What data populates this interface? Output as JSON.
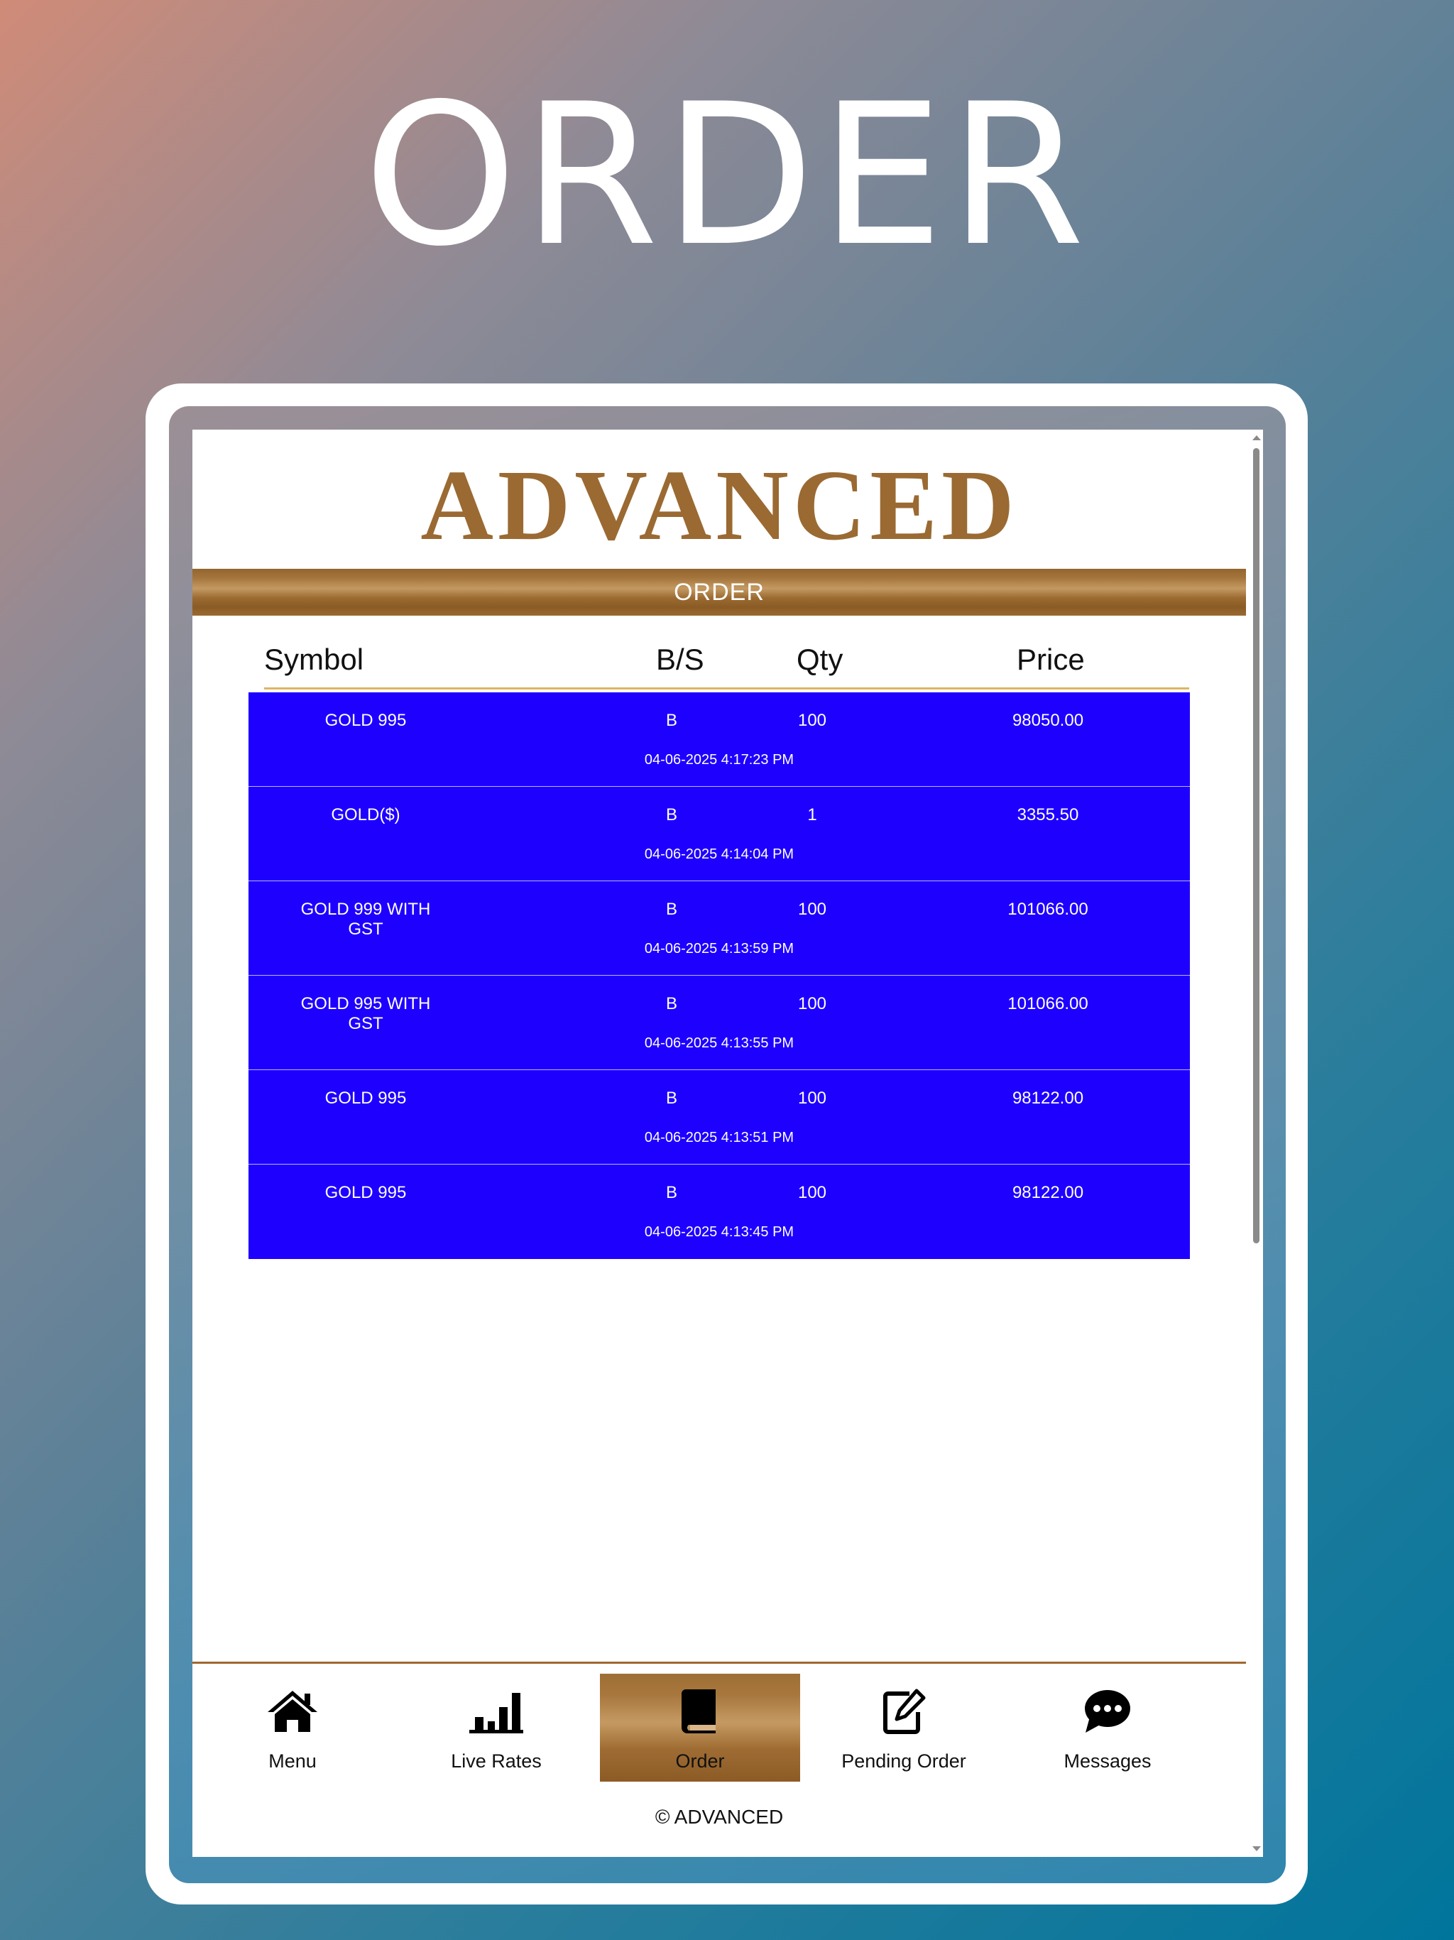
{
  "promo": {
    "title": "ORDER"
  },
  "app": {
    "logo_text": "ADVANCED",
    "section_title": "ORDER",
    "colors": {
      "brand_gold": "#9a6a32",
      "row_blue": "#1e00ff",
      "header_rule": "#e0b463"
    }
  },
  "table": {
    "headers": {
      "symbol": "Symbol",
      "side": "B/S",
      "qty": "Qty",
      "price": "Price"
    },
    "rows": [
      {
        "symbol": "GOLD 995",
        "side": "B",
        "qty": "100",
        "price": "98050.00",
        "time": "04-06-2025 4:17:23 PM"
      },
      {
        "symbol": "GOLD($)",
        "side": "B",
        "qty": "1",
        "price": "3355.50",
        "time": "04-06-2025 4:14:04 PM"
      },
      {
        "symbol": "GOLD 999 WITH GST",
        "side": "B",
        "qty": "100",
        "price": "101066.00",
        "time": "04-06-2025 4:13:59 PM"
      },
      {
        "symbol": "GOLD 995 WITH GST",
        "side": "B",
        "qty": "100",
        "price": "101066.00",
        "time": "04-06-2025 4:13:55 PM"
      },
      {
        "symbol": "GOLD 995",
        "side": "B",
        "qty": "100",
        "price": "98122.00",
        "time": "04-06-2025 4:13:51 PM"
      },
      {
        "symbol": "GOLD 995",
        "side": "B",
        "qty": "100",
        "price": "98122.00",
        "time": "04-06-2025 4:13:45 PM"
      }
    ]
  },
  "nav": {
    "items": [
      {
        "label": "Menu",
        "icon": "home-icon"
      },
      {
        "label": "Live Rates",
        "icon": "bar-chart-icon"
      },
      {
        "label": "Order",
        "icon": "book-icon",
        "active": true
      },
      {
        "label": "Pending Order",
        "icon": "edit-icon"
      },
      {
        "label": "Messages",
        "icon": "chat-bubble-icon"
      }
    ]
  },
  "footer": {
    "text": "© ADVANCED"
  }
}
